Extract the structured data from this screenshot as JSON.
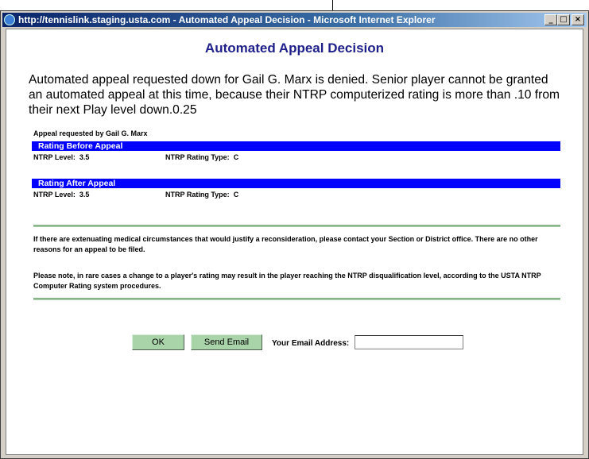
{
  "window": {
    "title": "http://tennislink.staging.usta.com - Automated Appeal Decision - Microsoft Internet Explorer",
    "minimize": "_",
    "maximize": "□",
    "close": "×"
  },
  "page": {
    "title": "Automated Appeal Decision",
    "message": "Automated appeal requested down for Gail G. Marx is denied. Senior player cannot be granted an automated appeal at this time, because their NTRP computerized rating is more than .10 from their next Play level down.0.25",
    "requested_by": "Appeal requested by Gail G. Marx"
  },
  "before": {
    "header": "Rating Before Appeal",
    "level_label": "NTRP Level:",
    "level_value": "3.5",
    "type_label": "NTRP Rating Type:",
    "type_value": "C"
  },
  "after": {
    "header": "Rating After Appeal",
    "level_label": "NTRP Level:",
    "level_value": "3.5",
    "type_label": "NTRP Rating Type:",
    "type_value": "C"
  },
  "notes": {
    "medical": "If there are extenuating medical circumstances that would justify a reconsideration, please contact your Section or District office. There are no other reasons for an appeal to be filed.",
    "disqualification": "Please note, in rare cases a change to a player's rating may result in the player reaching the NTRP disqualification level, according to the USTA NTRP Computer Rating system procedures."
  },
  "actions": {
    "ok_label": "OK",
    "send_label": "Send Email",
    "email_label": "Your Email Address:",
    "email_value": ""
  },
  "colors": {
    "section_bar": "#0000ff",
    "title_text": "#1f1f8a",
    "button_bg": "#a9d3a9",
    "divider": "#9fc79f"
  }
}
